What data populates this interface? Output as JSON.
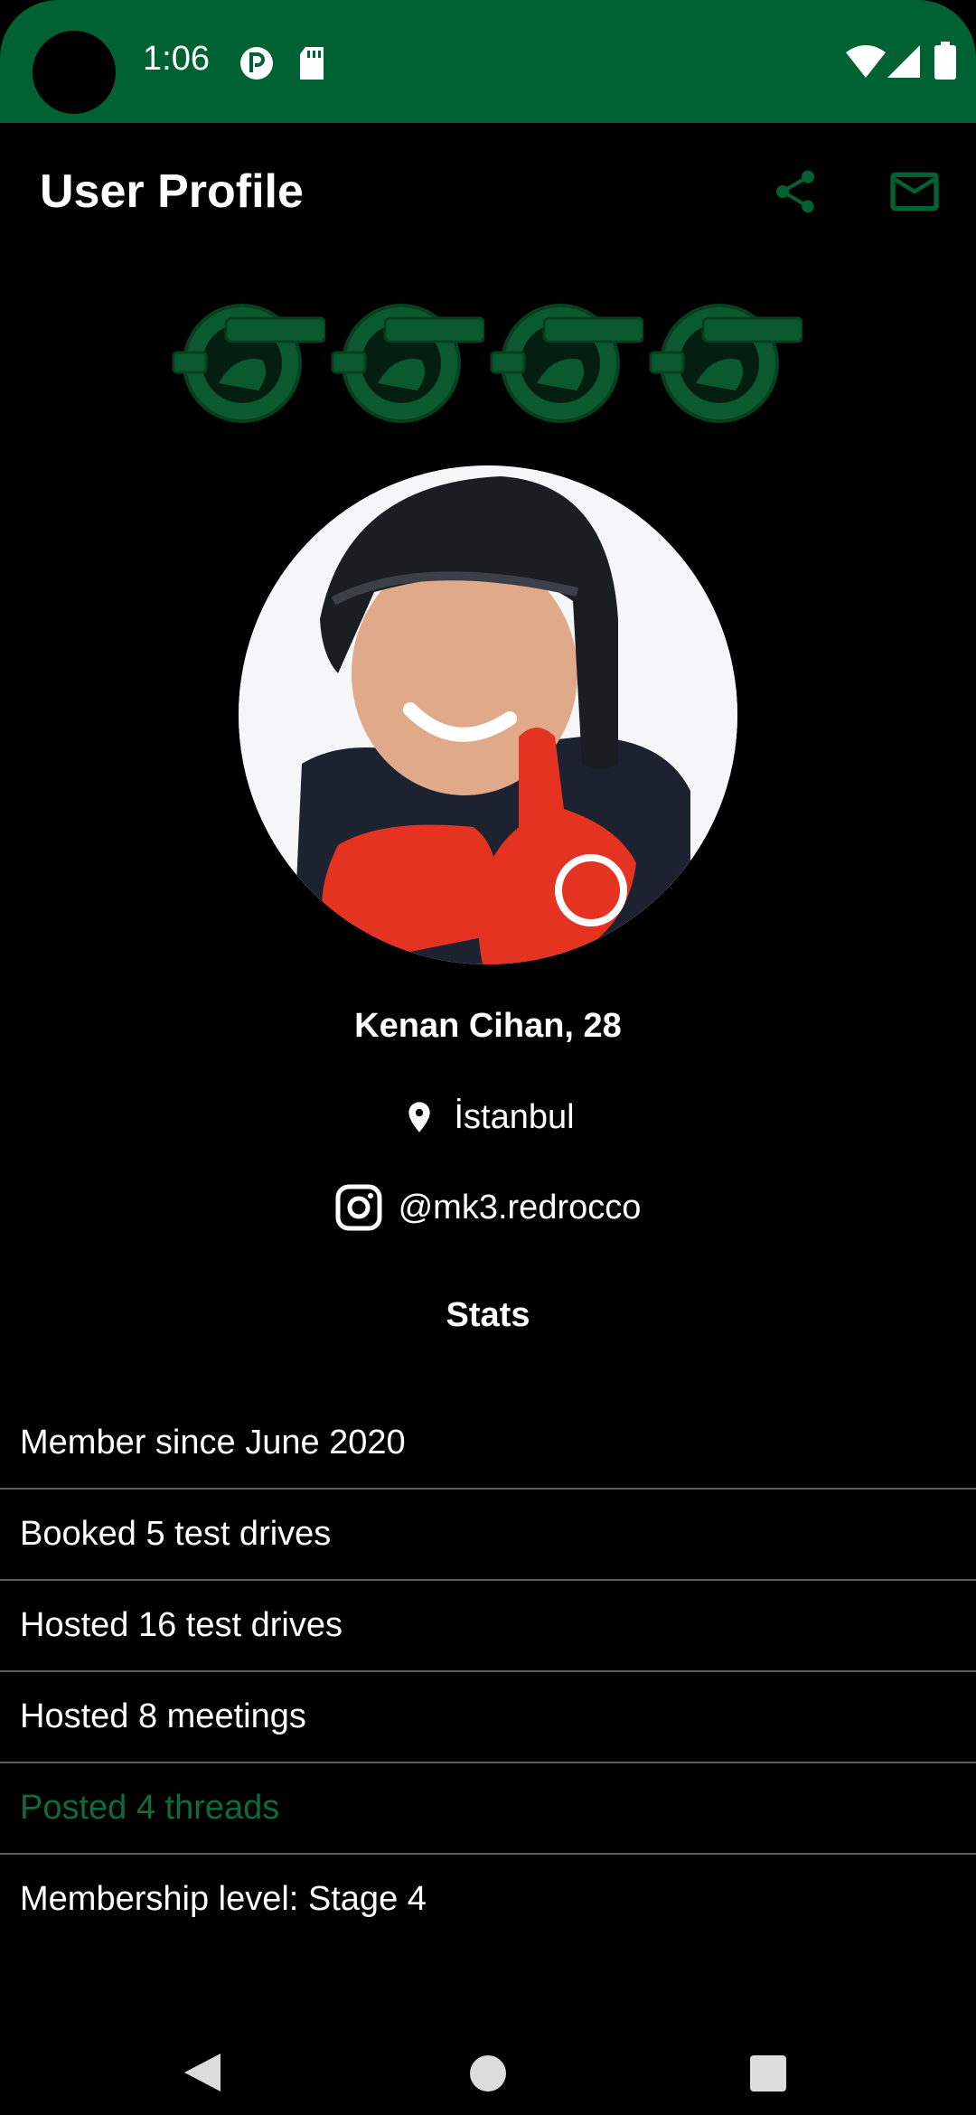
{
  "status_bar": {
    "time": "1:06",
    "icons": [
      "hotspot-icon",
      "sd-card-icon",
      "wifi-icon",
      "signal-icon",
      "battery-icon"
    ]
  },
  "app_bar": {
    "title": "User Profile",
    "actions": [
      "share-icon",
      "mail-icon"
    ]
  },
  "colors": {
    "status_bar_bg": "#006233",
    "accent": "#006233",
    "highlight_text": "#0f6b39",
    "background": "#000000",
    "divider": "#5c5c5c"
  },
  "badges": [
    "badge-icon",
    "badge-icon",
    "badge-icon",
    "badge-icon"
  ],
  "profile": {
    "name_age": "Kenan Cihan, 28",
    "location": "İstanbul",
    "instagram": "@mk3.redrocco"
  },
  "stats": {
    "title": "Stats",
    "items": [
      {
        "label": "Member since June 2020",
        "highlight": false
      },
      {
        "label": "Booked 5 test drives",
        "highlight": false
      },
      {
        "label": "Hosted 16 test drives",
        "highlight": false
      },
      {
        "label": "Hosted 8 meetings",
        "highlight": false
      },
      {
        "label": "Posted 4 threads",
        "highlight": true
      },
      {
        "label": "Membership level: Stage 4",
        "highlight": false
      }
    ]
  },
  "nav_bar": [
    "back-icon",
    "home-icon",
    "recents-icon"
  ]
}
